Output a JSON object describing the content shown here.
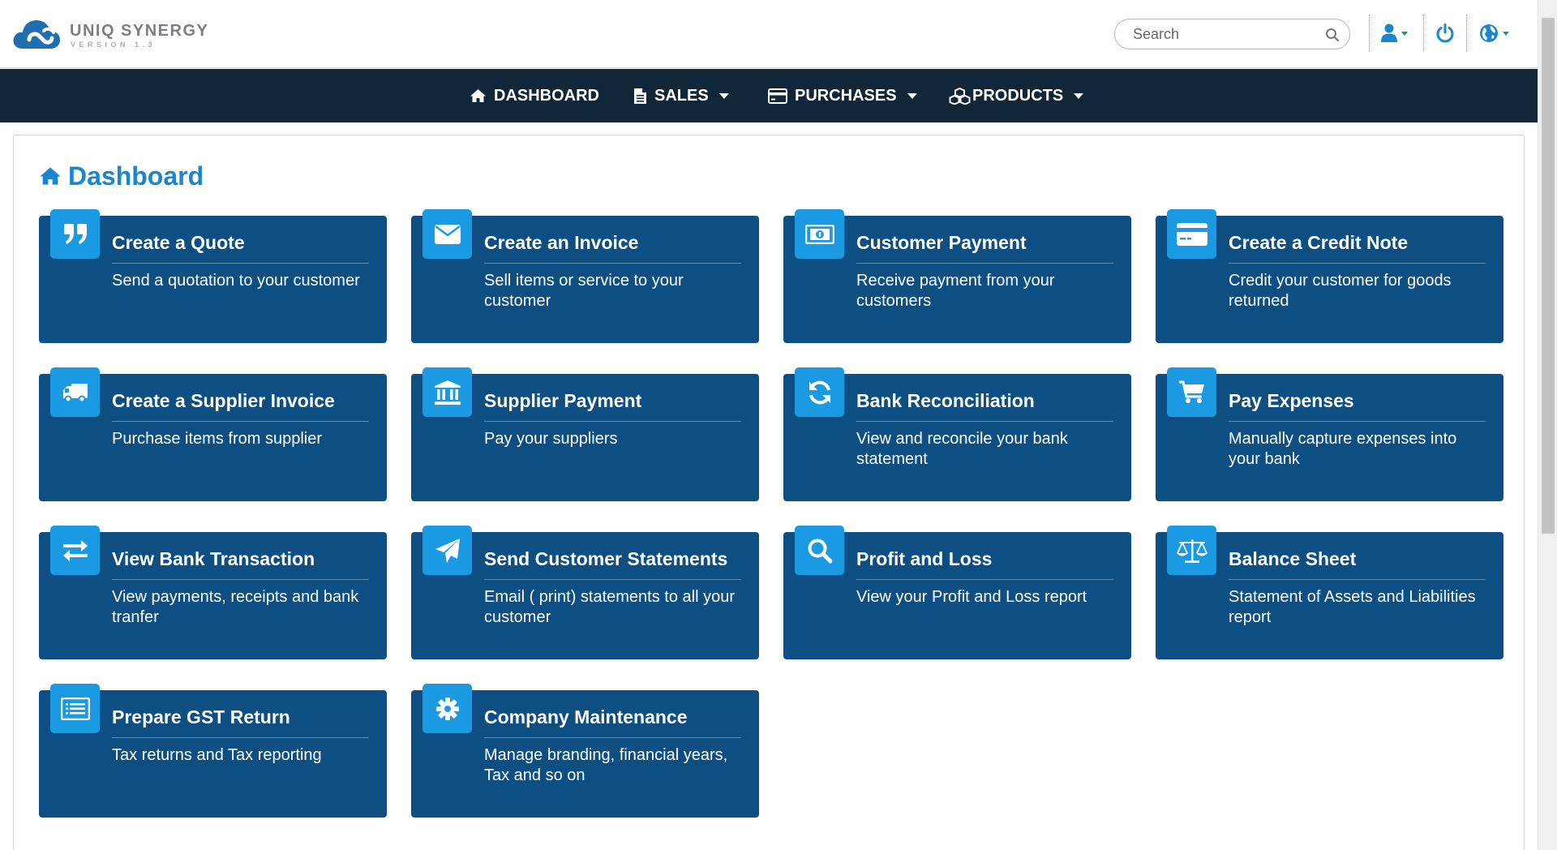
{
  "app": {
    "name": "UNIQ SYNERGY",
    "version": "VERSION 1.3"
  },
  "header": {
    "search_placeholder": "Search",
    "icons": [
      "user-icon",
      "power-icon",
      "globe-icon"
    ]
  },
  "nav": {
    "items": [
      {
        "label": "DASHBOARD",
        "icon": "home-icon",
        "dropdown": false
      },
      {
        "label": "SALES",
        "icon": "document-icon",
        "dropdown": true
      },
      {
        "label": "PURCHASES",
        "icon": "credit-card-icon",
        "dropdown": true
      },
      {
        "label": "PRODUCTS",
        "icon": "cubes-icon",
        "dropdown": true
      }
    ]
  },
  "page": {
    "title": "Dashboard",
    "icon": "home-icon"
  },
  "cards": [
    {
      "title": "Create a Quote",
      "desc": "Send a quotation to your customer",
      "icon": "quote-icon"
    },
    {
      "title": "Create an Invoice",
      "desc": "Sell items or service to your customer",
      "icon": "envelope-icon"
    },
    {
      "title": "Customer Payment",
      "desc": "Receive payment from your customers",
      "icon": "money-icon"
    },
    {
      "title": "Create a Credit Note",
      "desc": "Credit your customer for goods returned",
      "icon": "credit-card-icon"
    },
    {
      "title": "Create a Supplier Invoice",
      "desc": "Purchase items from supplier",
      "icon": "truck-icon"
    },
    {
      "title": "Supplier Payment",
      "desc": "Pay your suppliers",
      "icon": "bank-icon"
    },
    {
      "title": "Bank Reconciliation",
      "desc": "View and reconcile your bank statement",
      "icon": "refresh-icon"
    },
    {
      "title": "Pay Expenses",
      "desc": "Manually capture expenses into your bank",
      "icon": "cart-icon"
    },
    {
      "title": "View Bank Transaction",
      "desc": "View payments, receipts and bank tranfer",
      "icon": "exchange-icon"
    },
    {
      "title": "Send Customer Statements",
      "desc": "Email ( print) statements to all your customer",
      "icon": "paper-plane-icon"
    },
    {
      "title": "Profit and Loss",
      "desc": "View your Profit and Loss report",
      "icon": "search-icon"
    },
    {
      "title": "Balance Sheet",
      "desc": "Statement of Assets and Liabilities report",
      "icon": "balance-scale-icon"
    },
    {
      "title": "Prepare GST Return",
      "desc": "Tax returns and Tax reporting",
      "icon": "list-alt-icon"
    },
    {
      "title": "Company Maintenance",
      "desc": "Manage branding, financial years, Tax and so on",
      "icon": "gear-icon"
    }
  ],
  "colors": {
    "brand_blue": "#1a86d0",
    "card_bg": "#0d4f82",
    "card_icon_bg": "#1a9ae3",
    "navbar_bg": "#10273a"
  }
}
